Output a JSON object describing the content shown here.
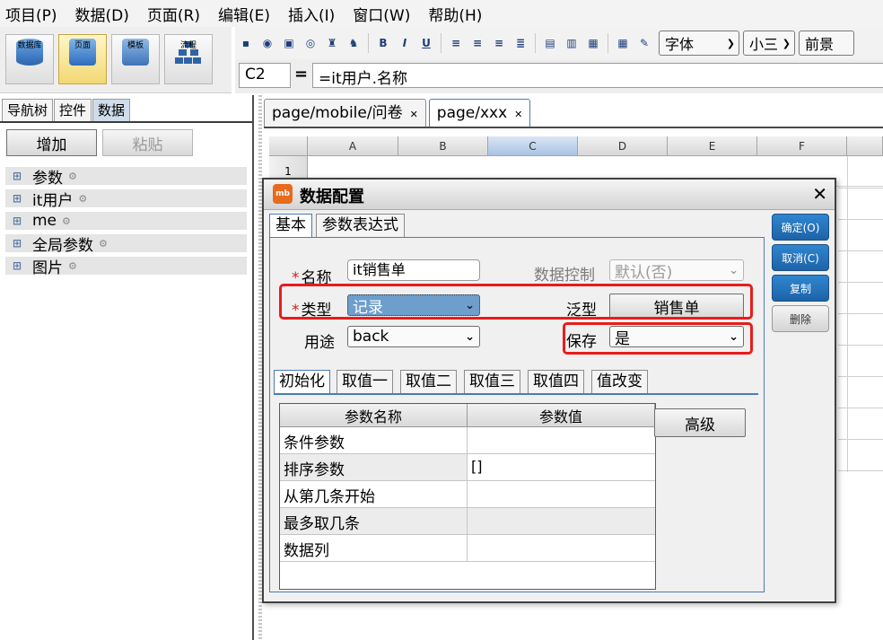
{
  "menu": [
    "项目(P)",
    "数据(D)",
    "页面(R)",
    "编辑(E)",
    "插入(I)",
    "窗口(W)",
    "帮助(H)"
  ],
  "toolbar": {
    "big_buttons": [
      {
        "label": "数据库",
        "icon": "database-icon"
      },
      {
        "label": "页面",
        "icon": "page-icon"
      },
      {
        "label": "模板",
        "icon": "template-icon"
      },
      {
        "label": "流程",
        "icon": "flow-icon"
      }
    ],
    "font_select": "字体",
    "size_select": "小三",
    "style_select": "前景"
  },
  "formula_bar": {
    "cell_ref": "C2",
    "equals": "=",
    "formula": "=it用户.名称"
  },
  "left_panel": {
    "tabs": [
      "导航树",
      "控件",
      "数据"
    ],
    "add_button": "增加",
    "paste_button": "粘贴",
    "tree_items": [
      "参数",
      "it用户",
      "me",
      "全局参数",
      "图片"
    ]
  },
  "doc_tabs": [
    "page/mobile/问卷",
    "page/xxx"
  ],
  "sheet": {
    "columns": [
      "A",
      "B",
      "C",
      "D",
      "E",
      "F"
    ],
    "row_label": "1"
  },
  "dialog": {
    "title": "数据配置",
    "logo": "mb",
    "tabs": [
      "基本",
      "参数表达式"
    ],
    "fields": {
      "required_mark": "*",
      "name_label": "名称",
      "name_value": "it销售单",
      "data_control_label": "数据控制",
      "data_control_value": "默认(否)",
      "type_label": "类型",
      "type_value": "记录",
      "generic_label": "泛型",
      "generic_value": "销售单",
      "usage_label": "用途",
      "usage_value": "back",
      "save_label": "保存",
      "save_value": "是"
    },
    "sub_tabs": [
      "初始化",
      "取值一",
      "取值二",
      "取值三",
      "取值四",
      "值改变"
    ],
    "table": {
      "headers": [
        "参数名称",
        "参数值"
      ],
      "rows": [
        {
          "name": "条件参数",
          "value": ""
        },
        {
          "name": "排序参数",
          "value": "[]"
        },
        {
          "name": "从第几条开始",
          "value": ""
        },
        {
          "name": "最多取几条",
          "value": ""
        },
        {
          "name": "数据列",
          "value": ""
        }
      ]
    },
    "advanced_button": "高级",
    "side_buttons": [
      "确定(O)",
      "取消(C)",
      "复制",
      "删除"
    ]
  }
}
